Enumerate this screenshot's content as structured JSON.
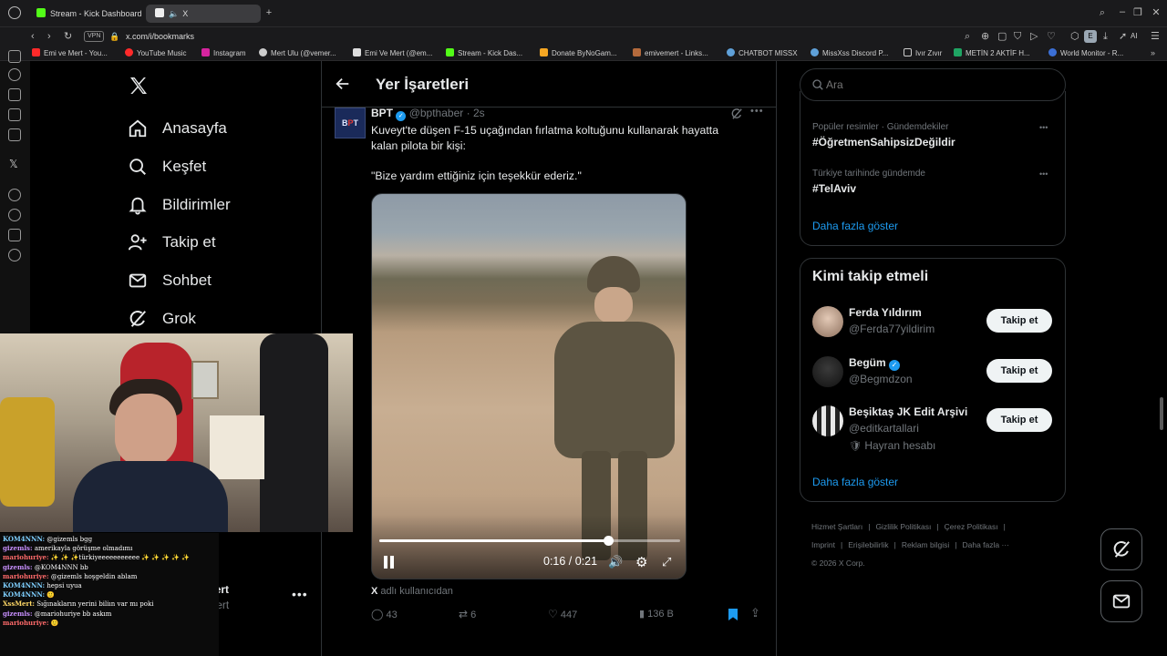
{
  "browser": {
    "tabs": [
      {
        "label": "Stream - Kick Dashboard",
        "active": false
      },
      {
        "label": "X",
        "active": true
      }
    ],
    "url": "x.com/i/bookmarks",
    "vpn_label": "VPN",
    "ai_label": "AI",
    "extension_letter": "E",
    "bookmarks": [
      "Emi ve Mert - You...",
      "YouTube Music",
      "Instagram",
      "Mert Ulu (@vemer...",
      "Emi Ve Mert (@em...",
      "Stream - Kick Das...",
      "Donate ByNoGam...",
      "emivemert - Links...",
      "CHATBOT MISSX",
      "MissXss Discord P...",
      "Ivır Zıvır",
      "METİN 2 AKTİF H...",
      "World Monitor - R..."
    ]
  },
  "nav": {
    "items": [
      "Anasayfa",
      "Keşfet",
      "Bildirimler",
      "Takip et",
      "Sohbet",
      "Grok"
    ]
  },
  "account": {
    "name": "Emi Ve Mert",
    "handle": "@emivemert"
  },
  "header": {
    "title": "Yer İşaretleri"
  },
  "tweet": {
    "author": "BPT",
    "handle": "@bpthaber",
    "time": "2s",
    "text_line1": "Kuveyt'te düşen F-15 uçağından fırlatma koltuğunu kullanarak hayatta kalan pilota bir kişi:",
    "text_line2": "\"Bize yardım ettiğiniz için teşekkür ederiz.\"",
    "video": {
      "time": "0:16 / 0:21",
      "progress": 0.76
    },
    "source_note": "adlı kullanıcıdan",
    "replies": "43",
    "reposts": "6",
    "likes": "447",
    "views": "136 B"
  },
  "search": {
    "placeholder": "Ara"
  },
  "trends": [
    {
      "context": "Popüler resimler · Gündemdekiler",
      "tag": "#ÖğretmenSahipsizDeğildir"
    },
    {
      "context": "Türkiye tarihinde gündemde",
      "tag": "#TelAviv"
    }
  ],
  "trends_more": "Daha fazla göster",
  "who_to_follow": {
    "title": "Kimi takip etmeli",
    "users": [
      {
        "name": "Ferda Yıldırım",
        "handle": "@Ferda77yildirim",
        "verified": false,
        "button": "Takip et"
      },
      {
        "name": "Begüm",
        "handle": "@Begmdzon",
        "verified": true,
        "button": "Takip et"
      },
      {
        "name": "Beşiktaş JK Edit Arşivi",
        "handle": "@editkartallari",
        "verified": false,
        "button": "Takip et",
        "badge": "Hayran hesabı"
      }
    ],
    "more": "Daha fazla göster"
  },
  "footer": {
    "links": [
      "Hizmet Şartları",
      "Gizlilik Politikası",
      "Çerez Politikası",
      "Imprint",
      "Erişilebilirlik",
      "Reklam bilgisi",
      "Daha fazla ···"
    ],
    "copyright": "© 2026 X Corp."
  },
  "chat": [
    {
      "name": "KOM4NNN:",
      "color": "#7fd0ff",
      "msg": "@gizemls bgg"
    },
    {
      "name": "gizemls:",
      "color": "#c890ff",
      "msg": "amerikayla görüşme olmadımı"
    },
    {
      "name": "mariohuriye:",
      "color": "#ff6a6a",
      "msg": "✨ ✨ ✨türkiyeeeeeeeeeee ✨ ✨ ✨ ✨ ✨"
    },
    {
      "name": "gizemls:",
      "color": "#c890ff",
      "msg": "@KOM4NNN bb"
    },
    {
      "name": "mariohuriye:",
      "color": "#ff6a6a",
      "msg": "@gizemls hoşgeldin ablam"
    },
    {
      "name": "KOM4NNN:",
      "color": "#7fd0ff",
      "msg": "hepsi uyua"
    },
    {
      "name": "KOM4NNN:",
      "color": "#7fd0ff",
      "msg": "🙂"
    },
    {
      "name": "XssMert:",
      "color": "#ffd866",
      "msg": "Sığınakların yerini biliın var mı poki"
    },
    {
      "name": "gizemls:",
      "color": "#c890ff",
      "msg": "@mariohuriye bb askım"
    },
    {
      "name": "mariohuriye:",
      "color": "#ff6a6a",
      "msg": "🙂"
    }
  ],
  "colors": {
    "accent": "#1d9bf0",
    "background": "#000000",
    "border": "#2f3336",
    "muted": "#71767b"
  }
}
